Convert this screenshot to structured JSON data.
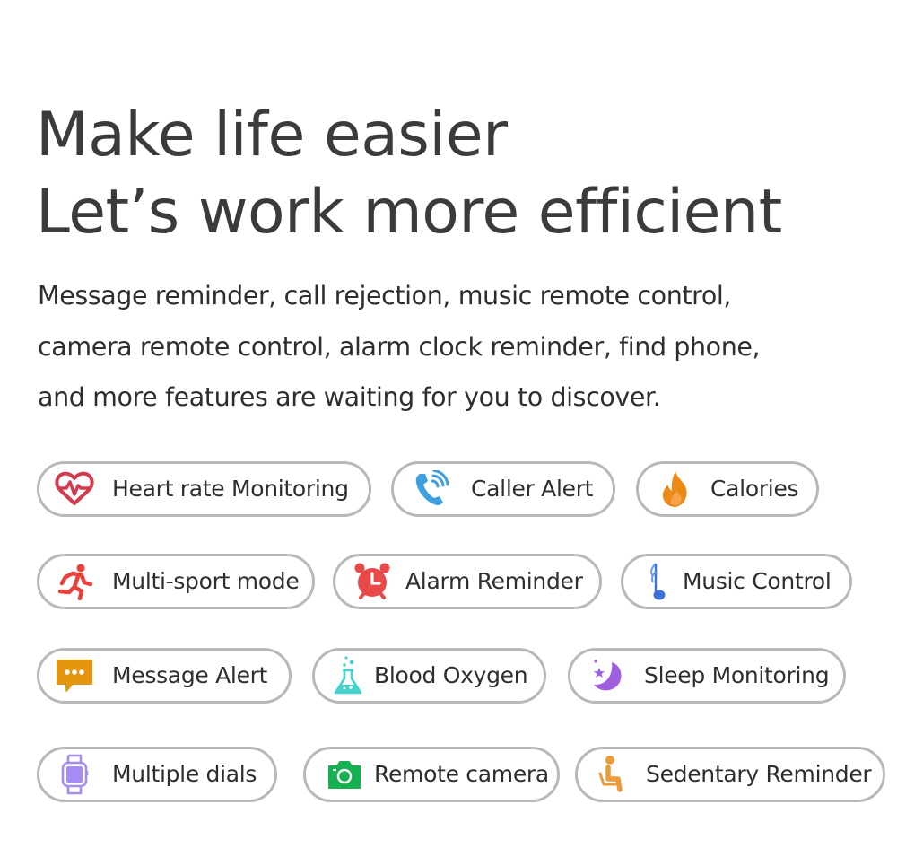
{
  "headline": {
    "line1": "Make life easier",
    "line2": "Let’s work more efficient"
  },
  "description": {
    "line1": "Message reminder, call rejection, music remote control,",
    "line2": "camera remote control, alarm clock reminder, find phone,",
    "line3": "and more features are waiting for you to discover."
  },
  "features": [
    {
      "label": "Heart rate Monitoring",
      "icon": "heart-rate-icon",
      "color": "#d23a4f"
    },
    {
      "label": "Caller Alert",
      "icon": "phone-call-icon",
      "color": "#3ea0e0"
    },
    {
      "label": "Calories",
      "icon": "flame-icon",
      "color": "#ec8a18"
    },
    {
      "label": "Multi-sport mode",
      "icon": "running-person-icon",
      "color": "#e8403a"
    },
    {
      "label": "Alarm Reminder",
      "icon": "alarm-clock-icon",
      "color": "#e84a4a"
    },
    {
      "label": "Music Control",
      "icon": "music-note-icon",
      "color": "#3d72d8"
    },
    {
      "label": "Message Alert",
      "icon": "message-bubble-icon",
      "color": "#e5960f"
    },
    {
      "label": "Blood Oxygen",
      "icon": "flask-icon",
      "color": "#45d2cc"
    },
    {
      "label": "Sleep Monitoring",
      "icon": "moon-star-icon",
      "color": "#a05ee0"
    },
    {
      "label": "Multiple dials",
      "icon": "smartwatch-icon",
      "color": "#a58cf0"
    },
    {
      "label": "Remote camera",
      "icon": "camera-icon",
      "color": "#15b050"
    },
    {
      "label": "Sedentary Reminder",
      "icon": "seated-person-icon",
      "color": "#ec9a3a"
    }
  ]
}
